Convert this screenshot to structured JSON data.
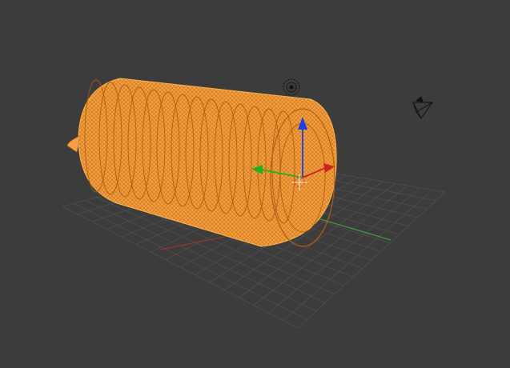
{
  "viewport": {
    "background_color": "#3c3c3c",
    "grid_color": "#4f4f4f",
    "x_axis_color": "#9b3434",
    "y_axis_color": "#3f9b3f",
    "selection_color": "#ffa43c",
    "gizmo_colors": {
      "x": "#d02020",
      "y": "#20b020",
      "z": "#1c3fe0"
    }
  },
  "scene_objects": [
    {
      "name": "coil-mesh",
      "icon": "spring-coil",
      "selected": true,
      "display": "wireframe"
    },
    {
      "name": "lamp",
      "icon": "light-icon",
      "selected": false
    },
    {
      "name": "camera",
      "icon": "camera-icon",
      "selected": false
    }
  ]
}
